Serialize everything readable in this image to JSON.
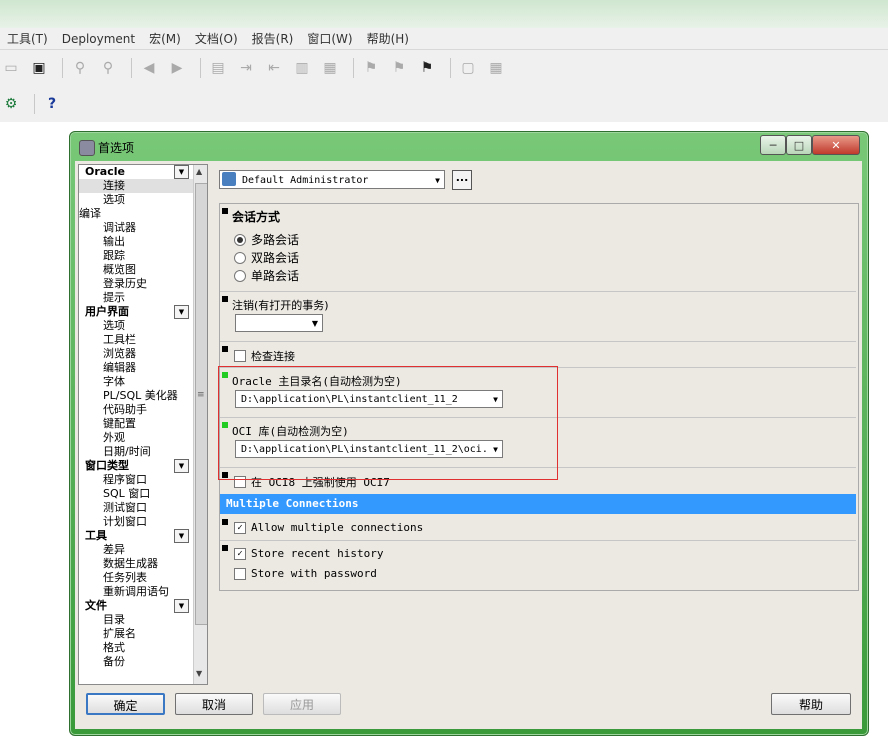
{
  "menubar": {
    "items": [
      "工具(T)",
      "Deployment",
      "宏(M)",
      "文档(O)",
      "报告(R)",
      "窗口(W)",
      "帮助(H)"
    ]
  },
  "dialog": {
    "title": "首选项",
    "caption_buttons": {
      "minimize": "─",
      "maximize": "□",
      "close": "✕"
    }
  },
  "tree": {
    "sections": [
      {
        "label": "Oracle",
        "items": [
          "连接",
          "选项"
        ]
      },
      {
        "label": "编译",
        "flat": true,
        "items": [
          "调试器",
          "输出",
          "跟踪",
          "概览图",
          "登录历史",
          "提示"
        ]
      },
      {
        "label": "用户界面",
        "items": [
          "选项",
          "工具栏",
          "浏览器",
          "编辑器",
          "字体",
          "PL/SQL 美化器",
          "代码助手",
          "键配置",
          "外观",
          "日期/时间"
        ]
      },
      {
        "label": "窗口类型",
        "items": [
          "程序窗口",
          "SQL 窗口",
          "测试窗口",
          "计划窗口"
        ]
      },
      {
        "label": "工具",
        "items": [
          "差异",
          "数据生成器",
          "任务列表",
          "重新调用语句"
        ]
      },
      {
        "label": "文件",
        "items": [
          "目录",
          "扩展名",
          "格式",
          "备份"
        ]
      }
    ],
    "selected": "连接"
  },
  "profile": {
    "value": "Default Administrator",
    "more": "..."
  },
  "settings": {
    "session_mode": {
      "title": "会话方式",
      "options": [
        "多路会话",
        "双路会话",
        "单路会话"
      ],
      "selected": 0
    },
    "logoff": {
      "label": "注销(有打开的事务)",
      "value": ""
    },
    "check_connection": {
      "label": "检查连接",
      "checked": false
    },
    "oracle_home": {
      "label": "Oracle 主目录名(自动检测为空)",
      "value": "D:\\application\\PL\\instantclient_11_2"
    },
    "oci_library": {
      "label": "OCI 库(自动检测为空)",
      "value": "D:\\application\\PL\\instantclient_11_2\\oci."
    },
    "force_oci7": {
      "label": "在 OCI8 上强制使用 OCI7",
      "checked": false
    },
    "multiple_connections": {
      "header": "Multiple Connections",
      "allow_label": "Allow multiple connections",
      "allow_checked": true,
      "store_history_label": "Store recent history",
      "store_history_checked": true,
      "store_password_label": "Store with password",
      "store_password_checked": false
    }
  },
  "buttons": {
    "ok": "确定",
    "cancel": "取消",
    "apply": "应用",
    "help": "帮助"
  },
  "colors": {
    "dialog_frame": "#3a9a3a",
    "highlight": "#3399ff",
    "annotation": "#e03030"
  }
}
